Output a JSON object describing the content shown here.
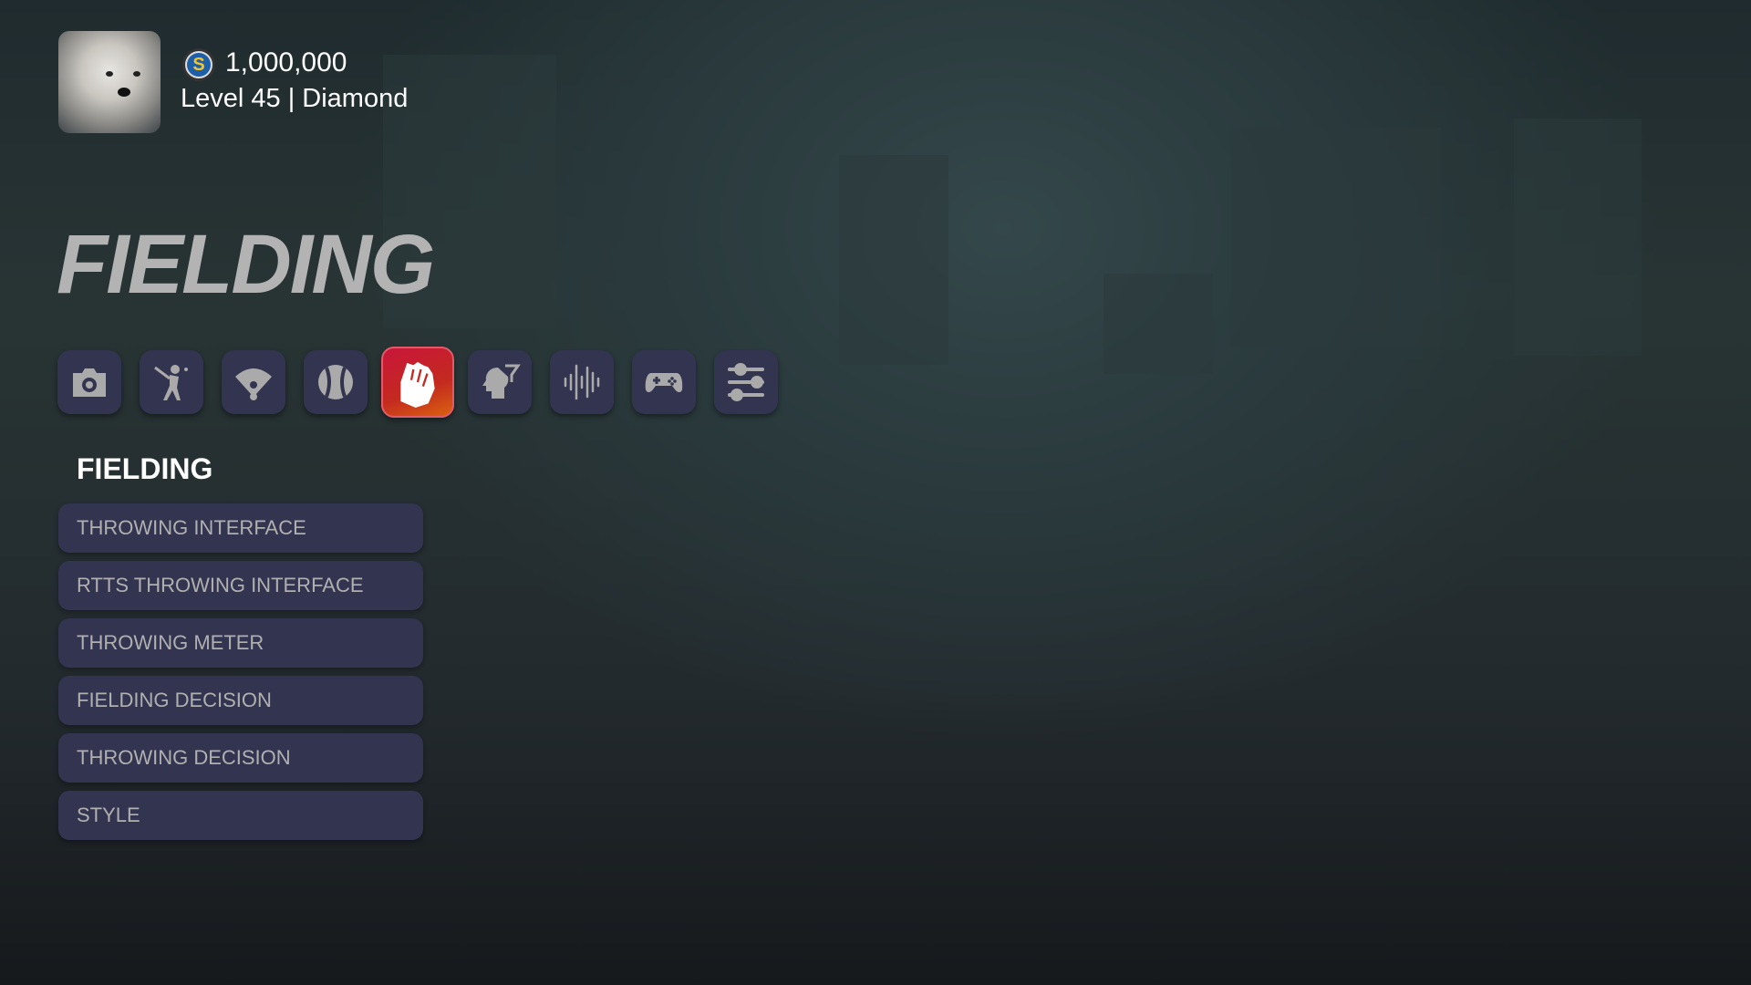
{
  "profile": {
    "credits": "1,000,000",
    "level": "Level 45 | Diamond",
    "coin_letter": "S"
  },
  "page": {
    "title": "FIELDING"
  },
  "tabs": [
    {
      "name": "camera",
      "icon": "camera-icon"
    },
    {
      "name": "batting",
      "icon": "batter-icon"
    },
    {
      "name": "field",
      "icon": "baseball-field-icon"
    },
    {
      "name": "pitching",
      "icon": "baseball-icon"
    },
    {
      "name": "fielding",
      "icon": "glove-icon",
      "selected": true
    },
    {
      "name": "mind",
      "icon": "head-icon"
    },
    {
      "name": "audio",
      "icon": "audio-wave-icon"
    },
    {
      "name": "controller",
      "icon": "gamepad-icon"
    },
    {
      "name": "settings",
      "icon": "sliders-icon"
    }
  ],
  "colors": {
    "accent": "#c8163a",
    "tile": "#333450"
  },
  "section": {
    "title": "FIELDING",
    "items": [
      "THROWING INTERFACE",
      "RTTS THROWING INTERFACE",
      "THROWING METER",
      "FIELDING DECISION",
      "THROWING DECISION",
      "STYLE"
    ]
  }
}
